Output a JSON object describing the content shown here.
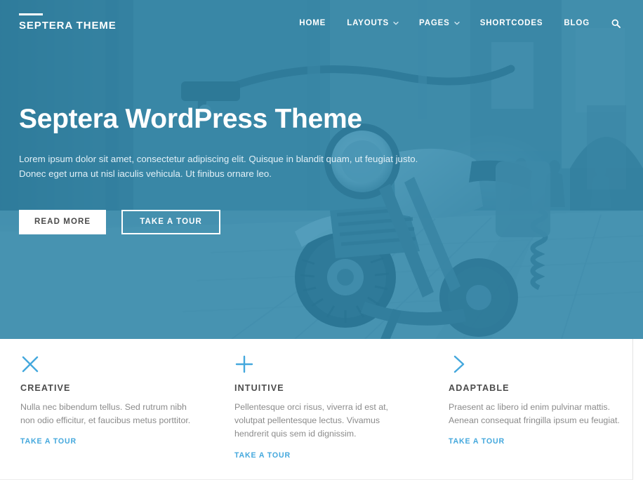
{
  "header": {
    "brand": "SEPTERA THEME",
    "nav": [
      {
        "label": "HOME",
        "caret": false
      },
      {
        "label": "LAYOUTS",
        "caret": true
      },
      {
        "label": "PAGES",
        "caret": true
      },
      {
        "label": "SHORTCODES",
        "caret": false
      },
      {
        "label": "BLOG",
        "caret": false
      }
    ],
    "search_icon": "search-icon"
  },
  "hero": {
    "title": "Septera WordPress Theme",
    "text": "Lorem ipsum dolor sit amet, consectetur adipiscing elit. Quisque in blandit quam, ut feugiat justo. Donec eget urna ut nisl iaculis vehicula. Ut finibus ornare leo.",
    "primary_button": "READ MORE",
    "secondary_button": "TAKE A TOUR",
    "overlay_color": "#2a86ac"
  },
  "features": [
    {
      "icon": "close-x-icon",
      "title": "CREATIVE",
      "text": "Nulla nec bibendum tellus. Sed rutrum nibh non odio efficitur, et faucibus metus porttitor.",
      "link": "TAKE A TOUR"
    },
    {
      "icon": "plus-icon",
      "title": "INTUITIVE",
      "text": "Pellentesque orci risus, viverra id est at, volutpat pellentesque lectus. Vivamus hendrerit quis sem id dignissim.",
      "link": "TAKE A TOUR"
    },
    {
      "icon": "chevron-right-icon",
      "title": "ADAPTABLE",
      "text": "Praesent ac libero id enim pulvinar mattis. Aenean consequat fringilla ipsum eu feugiat.",
      "link": "TAKE A TOUR"
    }
  ],
  "colors": {
    "accent": "#44a8dd",
    "hero_blue": "#2a86ac",
    "heading": "#4c4c4c",
    "body_text": "#8b8b8b"
  }
}
